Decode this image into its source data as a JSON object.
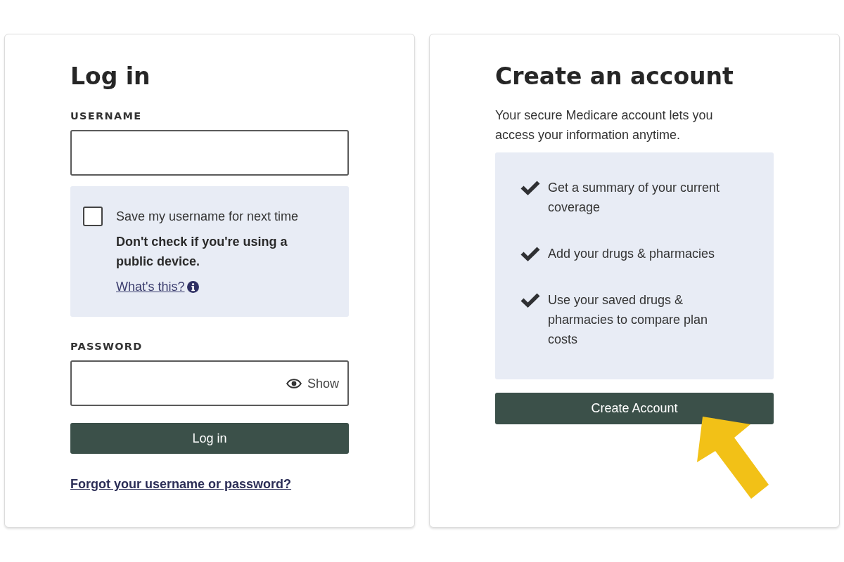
{
  "login": {
    "title": "Log in",
    "username": {
      "label": "USERNAME"
    },
    "remember": {
      "label": "Save my username for next time",
      "checked": false,
      "warning": "Don't check if you're using a public device.",
      "help_link": "What's this?"
    },
    "password": {
      "label": "PASSWORD",
      "toggle": "Show"
    },
    "submit": "Log in",
    "forgot_link": "Forgot your username or password?"
  },
  "create_account": {
    "title": "Create an account",
    "intro": "Your secure Medicare account lets you access your information anytime.",
    "benefits": [
      "Get a summary of your current coverage",
      "Add your drugs & pharmacies",
      "Use your saved drugs & pharmacies to compare plan costs"
    ],
    "button": "Create Account"
  }
}
